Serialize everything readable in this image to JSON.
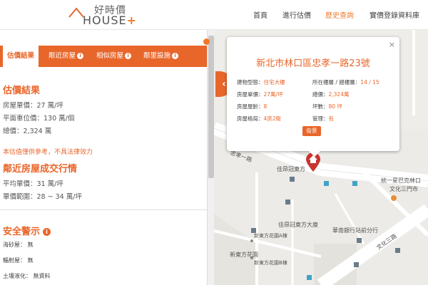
{
  "header": {
    "logo_cn": "好時價",
    "logo_en": "HOUSE",
    "logo_plus": "+",
    "nav": [
      "首頁",
      "進行估價",
      "歷史查詢",
      "實價登錄資料庫"
    ],
    "active_nav": "歷史查詢",
    "accent_color": "#e8662a"
  },
  "tabs": [
    {
      "label": "估價結果",
      "active": true
    },
    {
      "label": "鄰近房屋",
      "active": false,
      "info": "i"
    },
    {
      "label": "相似房屋",
      "active": false,
      "info": "i"
    },
    {
      "label": "鄰里設施",
      "active": false,
      "info": "i"
    }
  ],
  "estimate": {
    "title": "估價結果",
    "unit_price": "房屋單價：27 萬/坪",
    "parking_price": "平面車位價：130 萬/個",
    "total": "總價：2,324 萬"
  },
  "disclaimer": "本估值僅供參考，不具法律效力",
  "nearby": {
    "title": "鄰近房屋成交行情",
    "avg_price": "平均單價：31 萬/坪",
    "range": "單價範圍：28 ~ 34 萬/坪"
  },
  "safety": {
    "title": "安全警示",
    "info": "i",
    "items": [
      "海砂屋： 無",
      "輻射屋： 無",
      "土壤液化： 無資料"
    ]
  },
  "popup": {
    "close": "×",
    "address": "新北市林口區忠孝一路23號",
    "left": [
      {
        "label": "建物型態：",
        "value": "住宅大樓"
      },
      {
        "label": "房屋單價：",
        "value": "27萬/坪"
      },
      {
        "label": "房屋屋齡：",
        "value": "8"
      },
      {
        "label": "房屋格局：",
        "value": "4房2衛"
      }
    ],
    "right": [
      {
        "label": "所在樓層 / 總樓層：",
        "value": "14 / 15"
      },
      {
        "label": "總價：",
        "value": "2,324萬"
      },
      {
        "label": "坪數：",
        "value": "80 坪"
      },
      {
        "label": "管理：",
        "value": "有"
      }
    ],
    "street_view_button": "街景"
  },
  "map": {
    "labels": [
      "忠孝一路",
      "佳昂冠東方",
      "統一星巴克林口",
      "文化三門市",
      "佳昂冠東方大廈",
      "華南銀行站前分行",
      "新東方花園A棟",
      "新東方花園",
      "新東方花園B棟",
      "文化三路"
    ]
  },
  "icons": {
    "collapse": "chevron-left-icon",
    "marker": "home-marker-icon",
    "orange_dot": "warning-dot-icon"
  }
}
